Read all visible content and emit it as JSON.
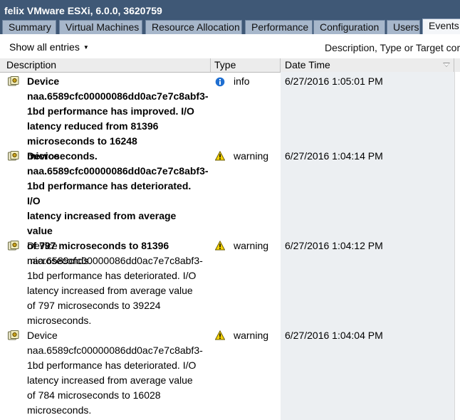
{
  "window": {
    "title": "felix VMware ESXi, 6.0.0, 3620759"
  },
  "tabs": [
    {
      "label": "Summary",
      "active": false
    },
    {
      "label": "Virtual Machines",
      "active": false
    },
    {
      "label": "Resource Allocation",
      "active": false
    },
    {
      "label": "Performance",
      "active": false
    },
    {
      "label": "Configuration",
      "active": false
    },
    {
      "label": "Users",
      "active": false
    },
    {
      "label": "Events",
      "active": true
    }
  ],
  "toolbar": {
    "show_all_label": "Show all entries",
    "filter_hint": "Description, Type or Target cor"
  },
  "columns": {
    "description": "Description",
    "type": "Type",
    "date_time": "Date Time"
  },
  "events": [
    {
      "icon": "event-icon",
      "type_icon": "info-icon",
      "type": "info",
      "date_time": "6/27/2016 1:05:01 PM",
      "lines": [
        "Device",
        "naa.6589cfc00000086dd0ac7e7c8abf3-",
        "1bd performance has improved. I/O",
        "latency reduced from 81396",
        "microseconds to 16248 microseconds."
      ]
    },
    {
      "icon": "event-icon",
      "type_icon": "warning-icon",
      "type": "warning",
      "date_time": "6/27/2016 1:04:14 PM",
      "lines": [
        "Device",
        "naa.6589cfc00000086dd0ac7e7c8abf3-",
        "1bd performance has deteriorated. I/O",
        "latency increased from average value",
        "of 797 microseconds to 81396",
        "microseconds."
      ]
    },
    {
      "icon": "event-icon",
      "type_icon": "warning-icon",
      "type": "warning",
      "date_time": "6/27/2016 1:04:12 PM",
      "lines": [
        "Device",
        "naa.6589cfc00000086dd0ac7e7c8abf3-",
        "1bd performance has deteriorated. I/O",
        "latency increased from average value",
        "of 797 microseconds to 39224",
        "microseconds."
      ]
    },
    {
      "icon": "event-icon",
      "type_icon": "warning-icon",
      "type": "warning",
      "date_time": "6/27/2016 1:04:04 PM",
      "lines": [
        "Device",
        "naa.6589cfc00000086dd0ac7e7c8abf3-",
        "1bd performance has deteriorated. I/O",
        "latency increased from average value",
        "of 784 microseconds to 16028",
        "microseconds."
      ]
    }
  ],
  "colors": {
    "titlebar": "#3f5876",
    "tab_inactive": "#a7b7cb",
    "tab_active": "#f4f6f9",
    "date_column_bg": "#eceff2",
    "info_blue": "#1f6fd1",
    "warning_yellow": "#f4d200"
  }
}
